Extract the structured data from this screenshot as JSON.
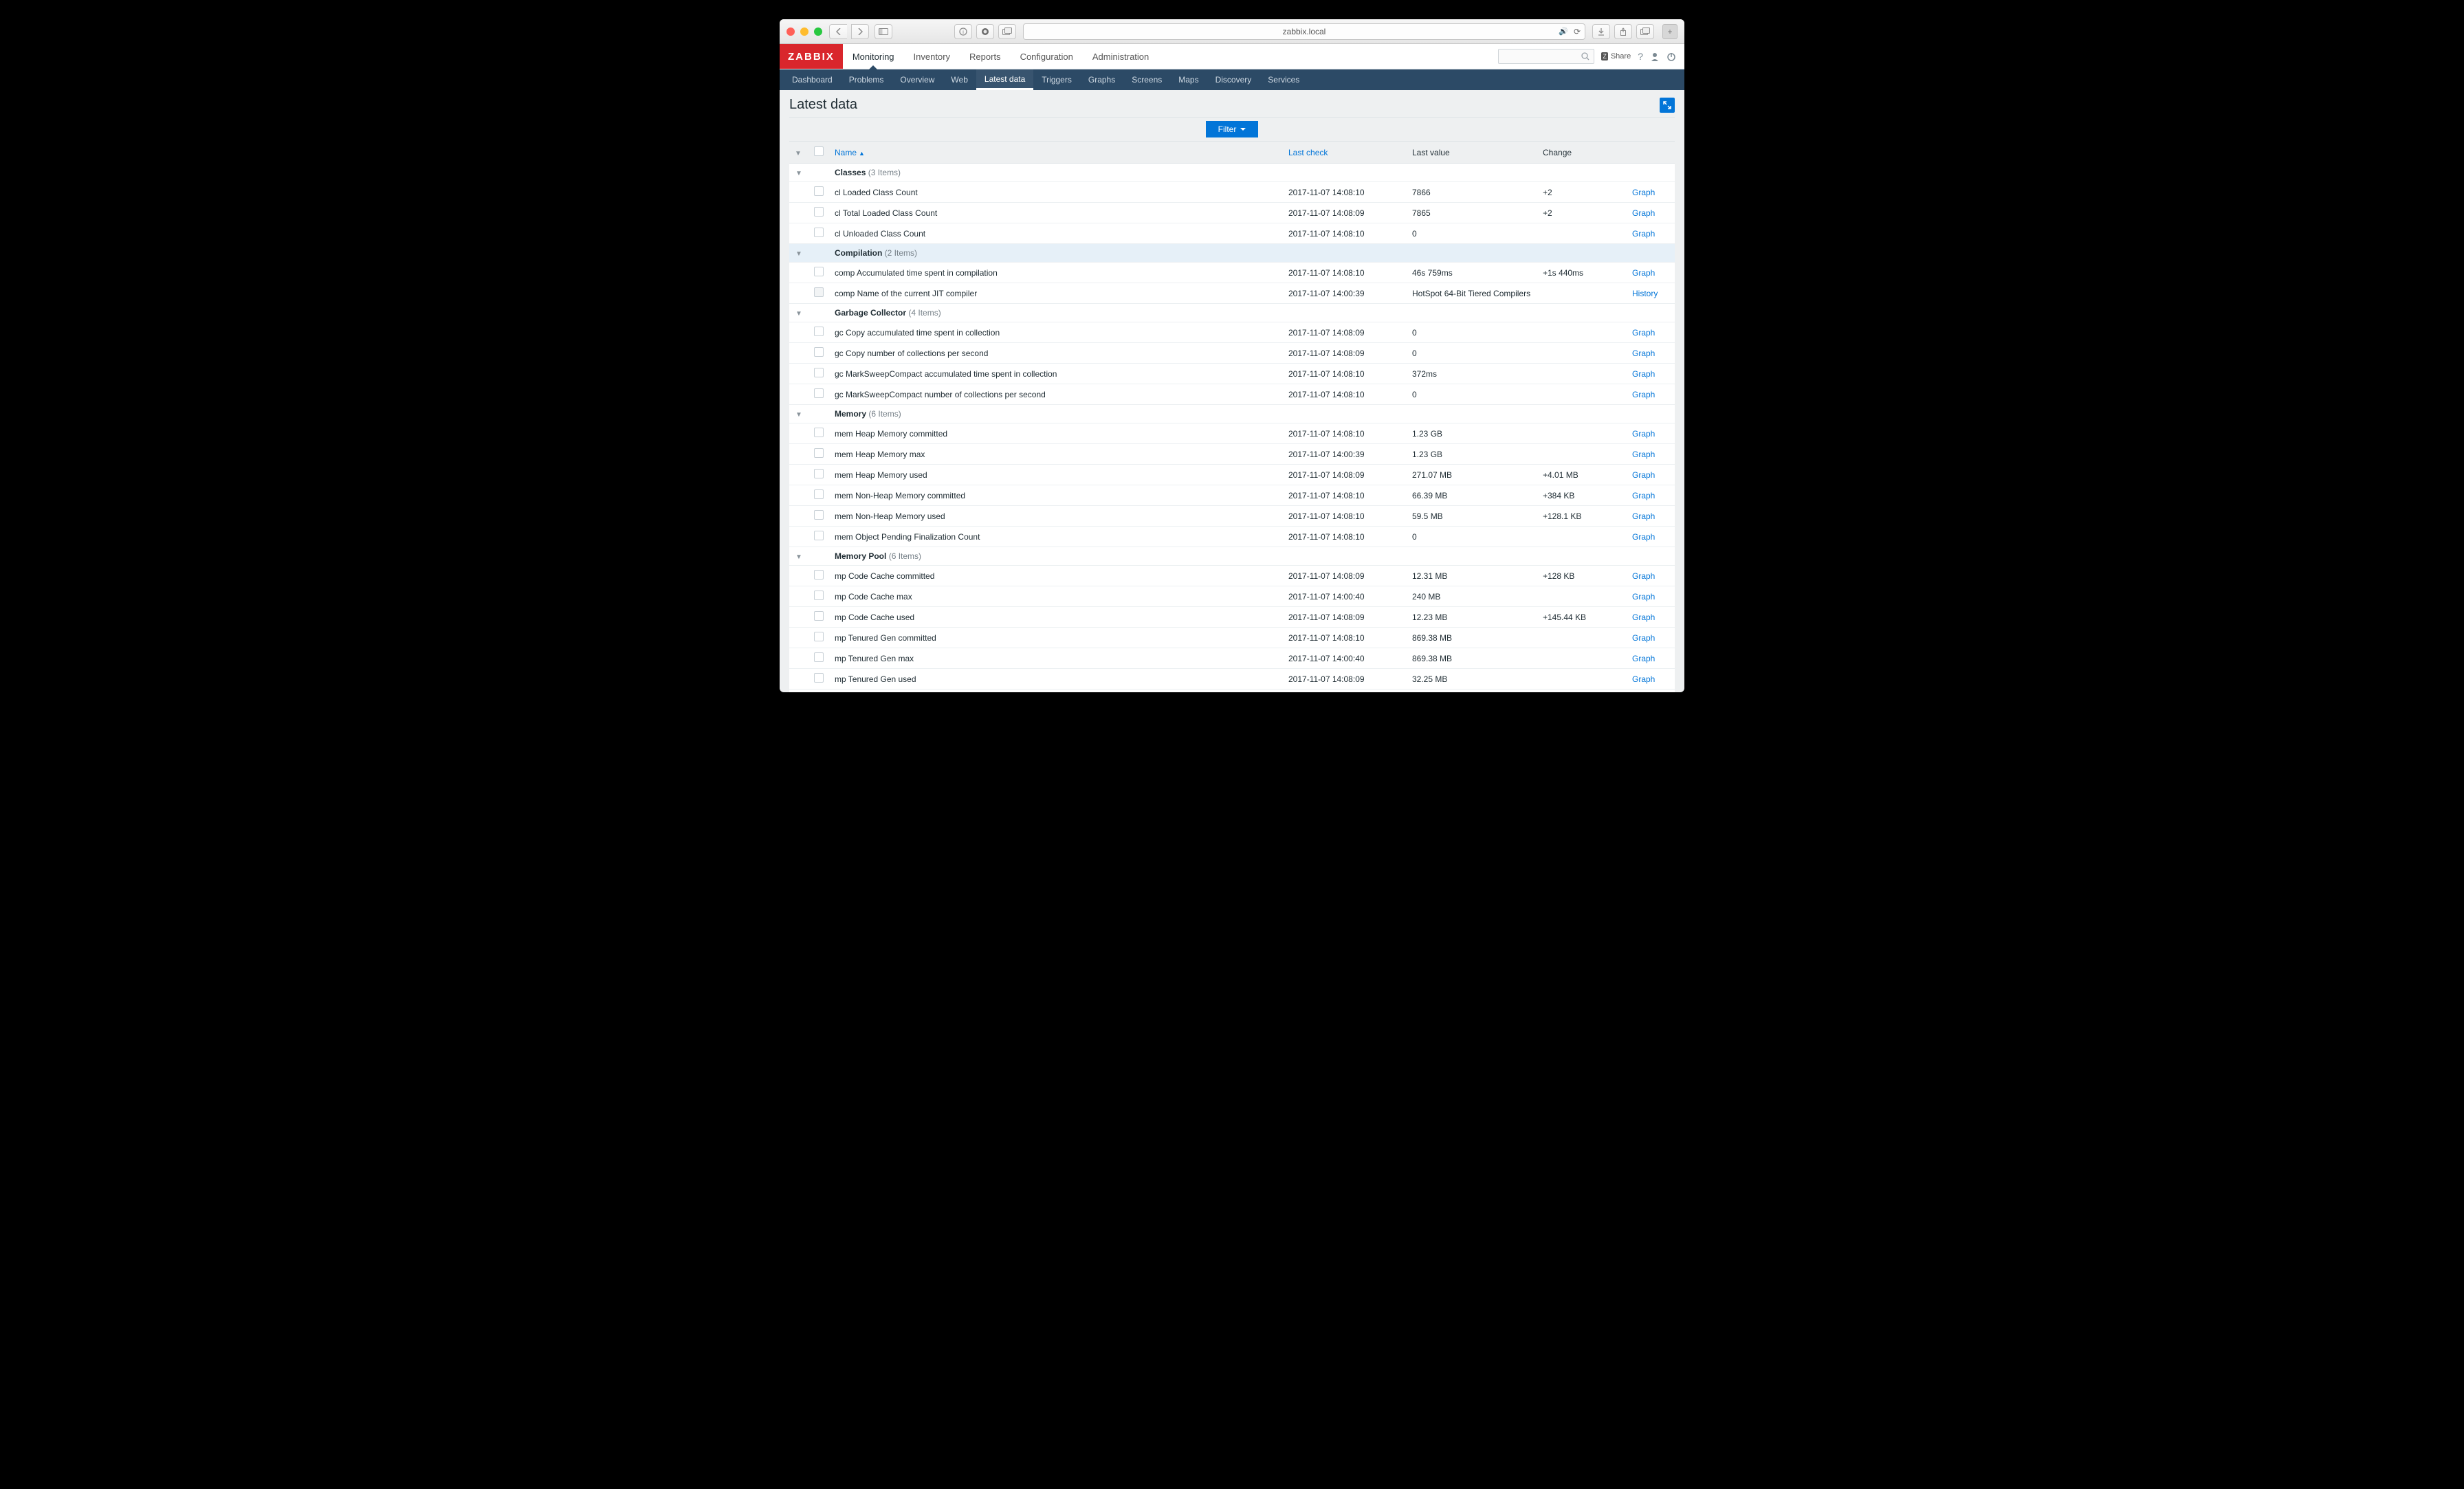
{
  "browser": {
    "url": "zabbix.local"
  },
  "header": {
    "logo": "ZABBIX",
    "topnav": [
      "Monitoring",
      "Inventory",
      "Reports",
      "Configuration",
      "Administration"
    ],
    "topnav_active": 0,
    "share": "Share",
    "subnav": [
      "Dashboard",
      "Problems",
      "Overview",
      "Web",
      "Latest data",
      "Triggers",
      "Graphs",
      "Screens",
      "Maps",
      "Discovery",
      "Services"
    ],
    "subnav_active": 4
  },
  "page": {
    "title": "Latest data",
    "filter_label": "Filter"
  },
  "columns": {
    "name": "Name",
    "last_check": "Last check",
    "last_value": "Last value",
    "change": "Change"
  },
  "groups": [
    {
      "name": "Classes",
      "count": "(3 Items)",
      "expanded": true,
      "rows": [
        {
          "name": "cl Loaded Class Count",
          "last": "2017-11-07 14:08:10",
          "val": "7866",
          "change": "+2",
          "action": "Graph"
        },
        {
          "name": "cl Total Loaded Class Count",
          "last": "2017-11-07 14:08:09",
          "val": "7865",
          "change": "+2",
          "action": "Graph"
        },
        {
          "name": "cl Unloaded Class Count",
          "last": "2017-11-07 14:08:10",
          "val": "0",
          "change": "",
          "action": "Graph"
        }
      ]
    },
    {
      "name": "Compilation",
      "count": "(2 Items)",
      "expanded": true,
      "highlight": true,
      "rows": [
        {
          "name": "comp Accumulated time spent in compilation",
          "last": "2017-11-07 14:08:10",
          "val": "46s 759ms",
          "change": "+1s 440ms",
          "action": "Graph"
        },
        {
          "name": "comp Name of the current JIT compiler",
          "last": "2017-11-07 14:00:39",
          "val": "HotSpot 64-Bit Tiered Compilers",
          "change": "",
          "action": "History",
          "disabled": true
        }
      ]
    },
    {
      "name": "Garbage Collector",
      "count": "(4 Items)",
      "expanded": true,
      "rows": [
        {
          "name": "gc Copy accumulated time spent in collection",
          "last": "2017-11-07 14:08:09",
          "val": "0",
          "change": "",
          "action": "Graph"
        },
        {
          "name": "gc Copy number of collections per second",
          "last": "2017-11-07 14:08:09",
          "val": "0",
          "change": "",
          "action": "Graph"
        },
        {
          "name": "gc MarkSweepCompact accumulated time spent in collection",
          "last": "2017-11-07 14:08:10",
          "val": "372ms",
          "change": "",
          "action": "Graph"
        },
        {
          "name": "gc MarkSweepCompact number of collections per second",
          "last": "2017-11-07 14:08:10",
          "val": "0",
          "change": "",
          "action": "Graph"
        }
      ]
    },
    {
      "name": "Memory",
      "count": "(6 Items)",
      "expanded": true,
      "rows": [
        {
          "name": "mem Heap Memory committed",
          "last": "2017-11-07 14:08:10",
          "val": "1.23 GB",
          "change": "",
          "action": "Graph"
        },
        {
          "name": "mem Heap Memory max",
          "last": "2017-11-07 14:00:39",
          "val": "1.23 GB",
          "change": "",
          "action": "Graph"
        },
        {
          "name": "mem Heap Memory used",
          "last": "2017-11-07 14:08:09",
          "val": "271.07 MB",
          "change": "+4.01 MB",
          "action": "Graph"
        },
        {
          "name": "mem Non-Heap Memory committed",
          "last": "2017-11-07 14:08:10",
          "val": "66.39 MB",
          "change": "+384 KB",
          "action": "Graph"
        },
        {
          "name": "mem Non-Heap Memory used",
          "last": "2017-11-07 14:08:10",
          "val": "59.5 MB",
          "change": "+128.1 KB",
          "action": "Graph"
        },
        {
          "name": "mem Object Pending Finalization Count",
          "last": "2017-11-07 14:08:10",
          "val": "0",
          "change": "",
          "action": "Graph"
        }
      ]
    },
    {
      "name": "Memory Pool",
      "count": "(6 Items)",
      "expanded": true,
      "rows": [
        {
          "name": "mp Code Cache committed",
          "last": "2017-11-07 14:08:09",
          "val": "12.31 MB",
          "change": "+128 KB",
          "action": "Graph"
        },
        {
          "name": "mp Code Cache max",
          "last": "2017-11-07 14:00:40",
          "val": "240 MB",
          "change": "",
          "action": "Graph"
        },
        {
          "name": "mp Code Cache used",
          "last": "2017-11-07 14:08:09",
          "val": "12.23 MB",
          "change": "+145.44 KB",
          "action": "Graph"
        },
        {
          "name": "mp Tenured Gen committed",
          "last": "2017-11-07 14:08:10",
          "val": "869.38 MB",
          "change": "",
          "action": "Graph"
        },
        {
          "name": "mp Tenured Gen max",
          "last": "2017-11-07 14:00:40",
          "val": "869.38 MB",
          "change": "",
          "action": "Graph"
        },
        {
          "name": "mp Tenured Gen used",
          "last": "2017-11-07 14:08:09",
          "val": "32.25 MB",
          "change": "",
          "action": "Graph"
        }
      ]
    }
  ]
}
